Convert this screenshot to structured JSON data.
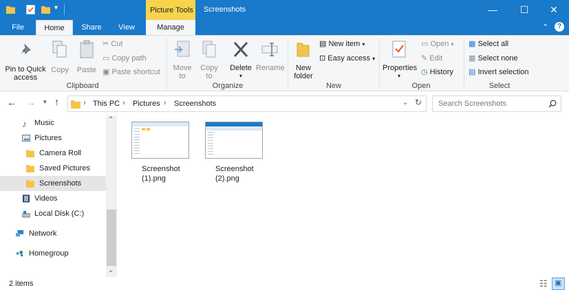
{
  "window": {
    "context_tab": "Picture Tools",
    "title": "Screenshots",
    "minimize": "—",
    "maximize": "☐",
    "close": "✕"
  },
  "ribbon_tabs": {
    "file": "File",
    "home": "Home",
    "share": "Share",
    "view": "View",
    "manage": "Manage"
  },
  "clipboard": {
    "pin_line1": "Pin to Quick",
    "pin_line2": "access",
    "copy": "Copy",
    "paste": "Paste",
    "cut": "Cut",
    "copy_path": "Copy path",
    "paste_shortcut": "Paste shortcut",
    "group": "Clipboard"
  },
  "organize": {
    "move_line1": "Move",
    "move_line2": "to",
    "copy_line1": "Copy",
    "copy_line2": "to",
    "delete": "Delete",
    "rename": "Rename",
    "group": "Organize"
  },
  "new": {
    "folder_line1": "New",
    "folder_line2": "folder",
    "new_item": "New item",
    "easy_access": "Easy access",
    "group": "New"
  },
  "open": {
    "properties": "Properties",
    "open": "Open",
    "edit": "Edit",
    "history": "History",
    "group": "Open"
  },
  "select": {
    "select_all": "Select all",
    "select_none": "Select none",
    "invert": "Invert selection",
    "group": "Select"
  },
  "address": {
    "crumbs": [
      "This PC",
      "Pictures",
      "Screenshots"
    ],
    "search_placeholder": "Search Screenshots"
  },
  "nav": [
    {
      "label": "Music",
      "icon": "music-icon"
    },
    {
      "label": "Pictures",
      "icon": "pictures-icon"
    },
    {
      "label": "Camera Roll",
      "icon": "folder-icon"
    },
    {
      "label": "Saved Pictures",
      "icon": "folder-icon"
    },
    {
      "label": "Screenshots",
      "icon": "folder-icon",
      "selected": true
    },
    {
      "label": "Videos",
      "icon": "videos-icon"
    },
    {
      "label": "Local Disk (C:)",
      "icon": "drive-icon"
    },
    {
      "label": "Network",
      "icon": "network-icon"
    },
    {
      "label": "Homegroup",
      "icon": "homegroup-icon"
    }
  ],
  "files": [
    {
      "line1": "Screenshot",
      "line2": "(1).png"
    },
    {
      "line1": "Screenshot",
      "line2": "(2).png"
    }
  ],
  "status": {
    "count": "2 items"
  },
  "colors": {
    "titlebar": "#1979ca",
    "context_tab": "#f7d44c",
    "folder": "#f4c54c",
    "selected_nav": "#e5e5e5"
  }
}
